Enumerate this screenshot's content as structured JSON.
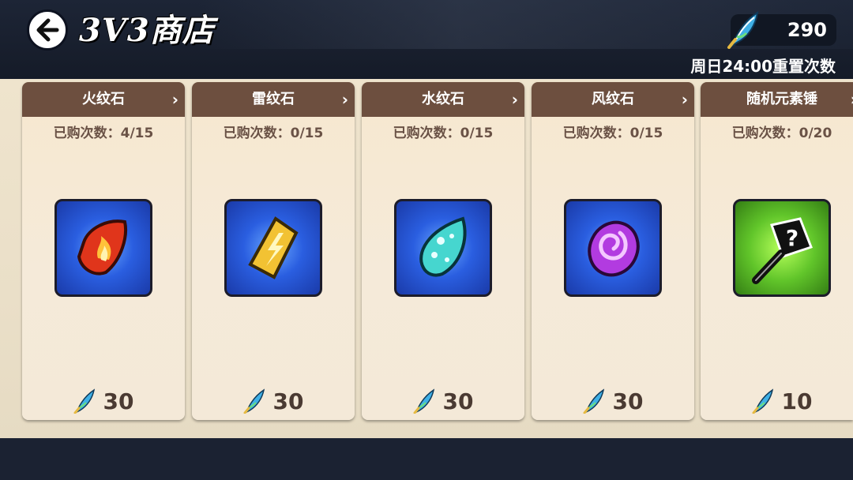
{
  "header": {
    "back_icon": "left-arrow-icon",
    "title": "3V3商店",
    "currency_icon": "blue-feather-icon",
    "currency_amount": "290",
    "reset_text": "周日24:00重置次数"
  },
  "cards": [
    {
      "name": "火纹石",
      "count": "已购次数：4/15",
      "price": "30",
      "item_icon": "fire-rune-stone-icon"
    },
    {
      "name": "雷纹石",
      "count": "已购次数：0/15",
      "price": "30",
      "item_icon": "thunder-rune-stone-icon"
    },
    {
      "name": "水纹石",
      "count": "已购次数：0/15",
      "price": "30",
      "item_icon": "water-rune-stone-icon"
    },
    {
      "name": "风纹石",
      "count": "已购次数：0/15",
      "price": "30",
      "item_icon": "wind-rune-stone-icon"
    },
    {
      "name": "随机元素锤",
      "count": "已购次数：0/20",
      "price": "10",
      "item_icon": "mystery-hammer-icon"
    }
  ],
  "colors": {
    "card_header": "#6d4f3f",
    "panel": "#efe4cd",
    "topbar": "#1d2536"
  }
}
